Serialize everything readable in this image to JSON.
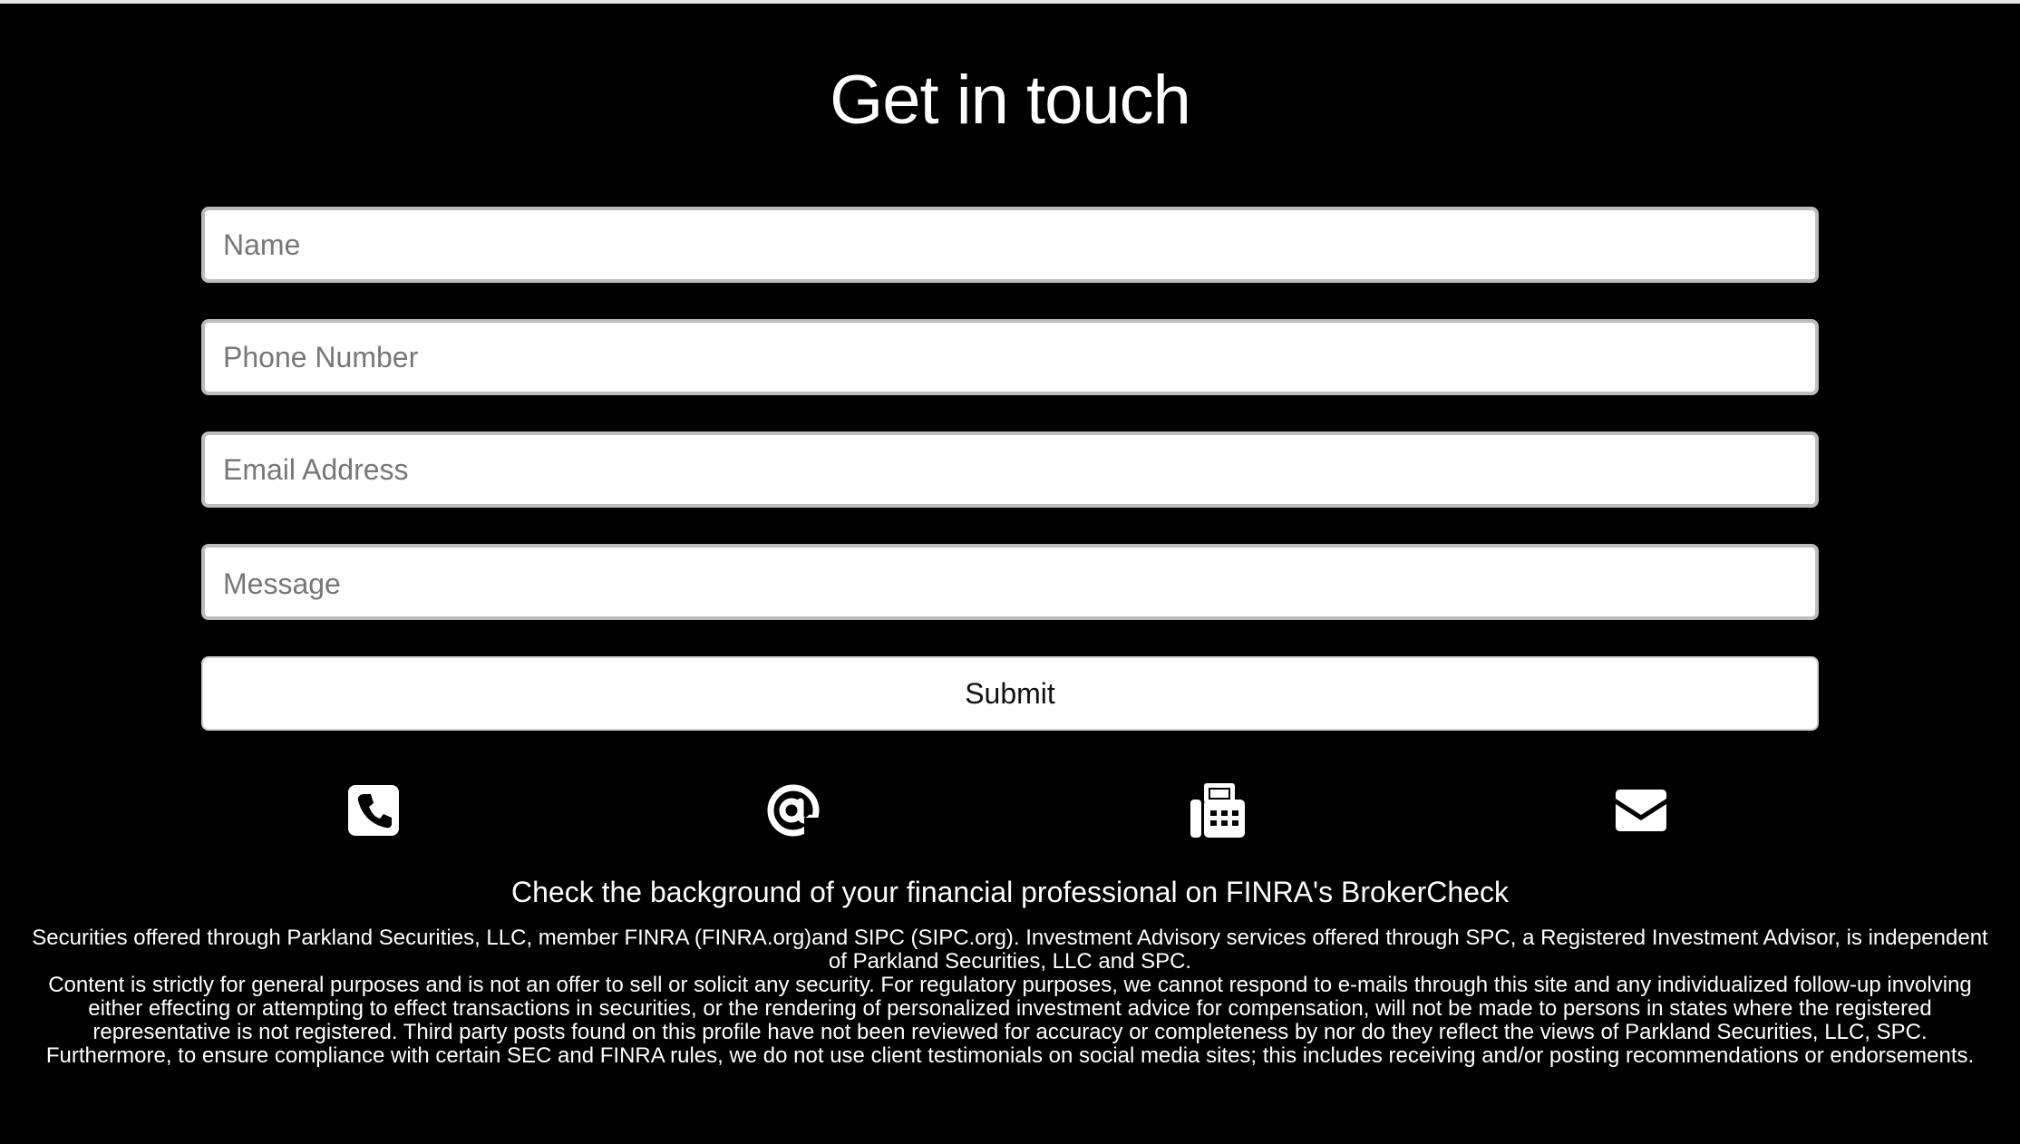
{
  "contact": {
    "title": "Get in touch",
    "fields": {
      "name_placeholder": "Name",
      "phone_placeholder": "Phone Number",
      "email_placeholder": "Email Address",
      "message_placeholder": "Message"
    },
    "submit_label": "Submit"
  },
  "icons": [
    "phone-icon",
    "at-icon",
    "fax-icon",
    "envelope-icon"
  ],
  "footer": {
    "brokercheck_text": "Check the background of your financial professional on FINRA's BrokerCheck",
    "disclaimer_1": "Securities offered through Parkland Securities, LLC, member FINRA (FINRA.org)and SIPC (SIPC.org). Investment Advisory services offered through SPC, a Registered Investment Advisor, is independent of Parkland Securities, LLC and SPC.",
    "disclaimer_2": "Content is strictly for general purposes and is not an offer to sell or solicit any security. For regulatory purposes, we cannot respond to e-mails through this site and any individualized follow-up involving either effecting or attempting to effect transactions in securities, or the rendering of personalized investment advice for compensation, will not be made to persons in states where the registered representative is not registered. Third party posts found on this profile have not been reviewed for accuracy or completeness by nor do they reflect the views of Parkland Securities, LLC, SPC. Furthermore, to ensure compliance with certain SEC and FINRA rules, we do not use client testimonials on social media sites; this includes receiving and/or posting recommendations or endorsements."
  },
  "colors": {
    "background": "#000000",
    "text": "#ffffff",
    "field_border": "#bdbdbd"
  }
}
